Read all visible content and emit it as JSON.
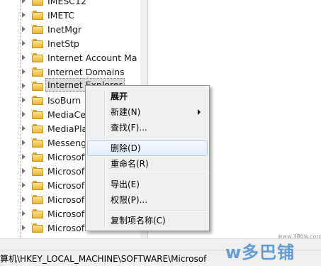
{
  "tree": {
    "items": [
      {
        "label": "IMESC12",
        "selected": false
      },
      {
        "label": "IMETC",
        "selected": false
      },
      {
        "label": "InetMgr",
        "selected": false
      },
      {
        "label": "InetStp",
        "selected": false
      },
      {
        "label": "Internet Account Ma",
        "selected": false
      },
      {
        "label": "Internet Domains",
        "selected": false
      },
      {
        "label": "Internet Explorer",
        "selected": true
      },
      {
        "label": "IsoBurn",
        "selected": false
      },
      {
        "label": "MediaCe",
        "selected": false
      },
      {
        "label": "MediaPla",
        "selected": false
      },
      {
        "label": "Messeng",
        "selected": false
      },
      {
        "label": "Microsof",
        "selected": false
      },
      {
        "label": "Microsof",
        "selected": false
      },
      {
        "label": "Microsof",
        "selected": false
      },
      {
        "label": "Microsof",
        "selected": false
      },
      {
        "label": "Microsof",
        "selected": false
      },
      {
        "label": "Microsof",
        "selected": false
      }
    ]
  },
  "context_menu": {
    "expand": "展开",
    "new": "新建(N)",
    "find": "查找(F)...",
    "delete": "删除(D)",
    "rename": "重命名(R)",
    "export": "导出(E)",
    "permissions": "权限(P)...",
    "copy_key_name": "复制项名称(C)"
  },
  "status_bar": {
    "path": "算机\\HKEY_LOCAL_MACHINE\\SOFTWARE\\Microsof"
  },
  "watermark": {
    "url": "www.386w.com",
    "logo": "w多巴铺"
  },
  "colors": {
    "folder": "#e9b53a",
    "menu_bg": "#f0f0f0",
    "hover_border": "#aecff7",
    "watermark": "#4b8fd0"
  }
}
